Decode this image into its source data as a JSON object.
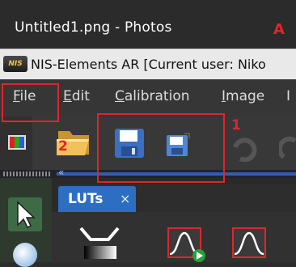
{
  "photos_window": {
    "title": "Untitled1.png - Photos"
  },
  "app": {
    "logo_text": "NIS",
    "title": "NIS-Elements AR [Current user: Niko"
  },
  "menu": {
    "items": [
      {
        "accel": "F",
        "rest": "ile"
      },
      {
        "accel": "E",
        "rest": "dit"
      },
      {
        "accel": "C",
        "rest": "alibration"
      },
      {
        "accel": "I",
        "rest": "mage"
      },
      {
        "accel": "",
        "rest": "I"
      }
    ]
  },
  "toolbar": {
    "icons": [
      "rgb-channels-icon",
      "open-folder-icon",
      "save-icon",
      "save-as-icon",
      "undo-icon",
      "redo-icon"
    ]
  },
  "panel": {
    "tab_label": "LUTs",
    "tab_close": "×",
    "collapse_glyph": "«",
    "lut_icons": [
      "lut-gradient-icon",
      "lut-curve-play-icon",
      "lut-curve-icon"
    ]
  },
  "annotations": {
    "letter": "A",
    "label_1": "1",
    "label_2": "2",
    "color": "#e1252a"
  },
  "colors": {
    "accent_tab": "#2c6fc2",
    "menubar_bg": "#363636",
    "titlebar_bg": "#2b2b2b"
  }
}
